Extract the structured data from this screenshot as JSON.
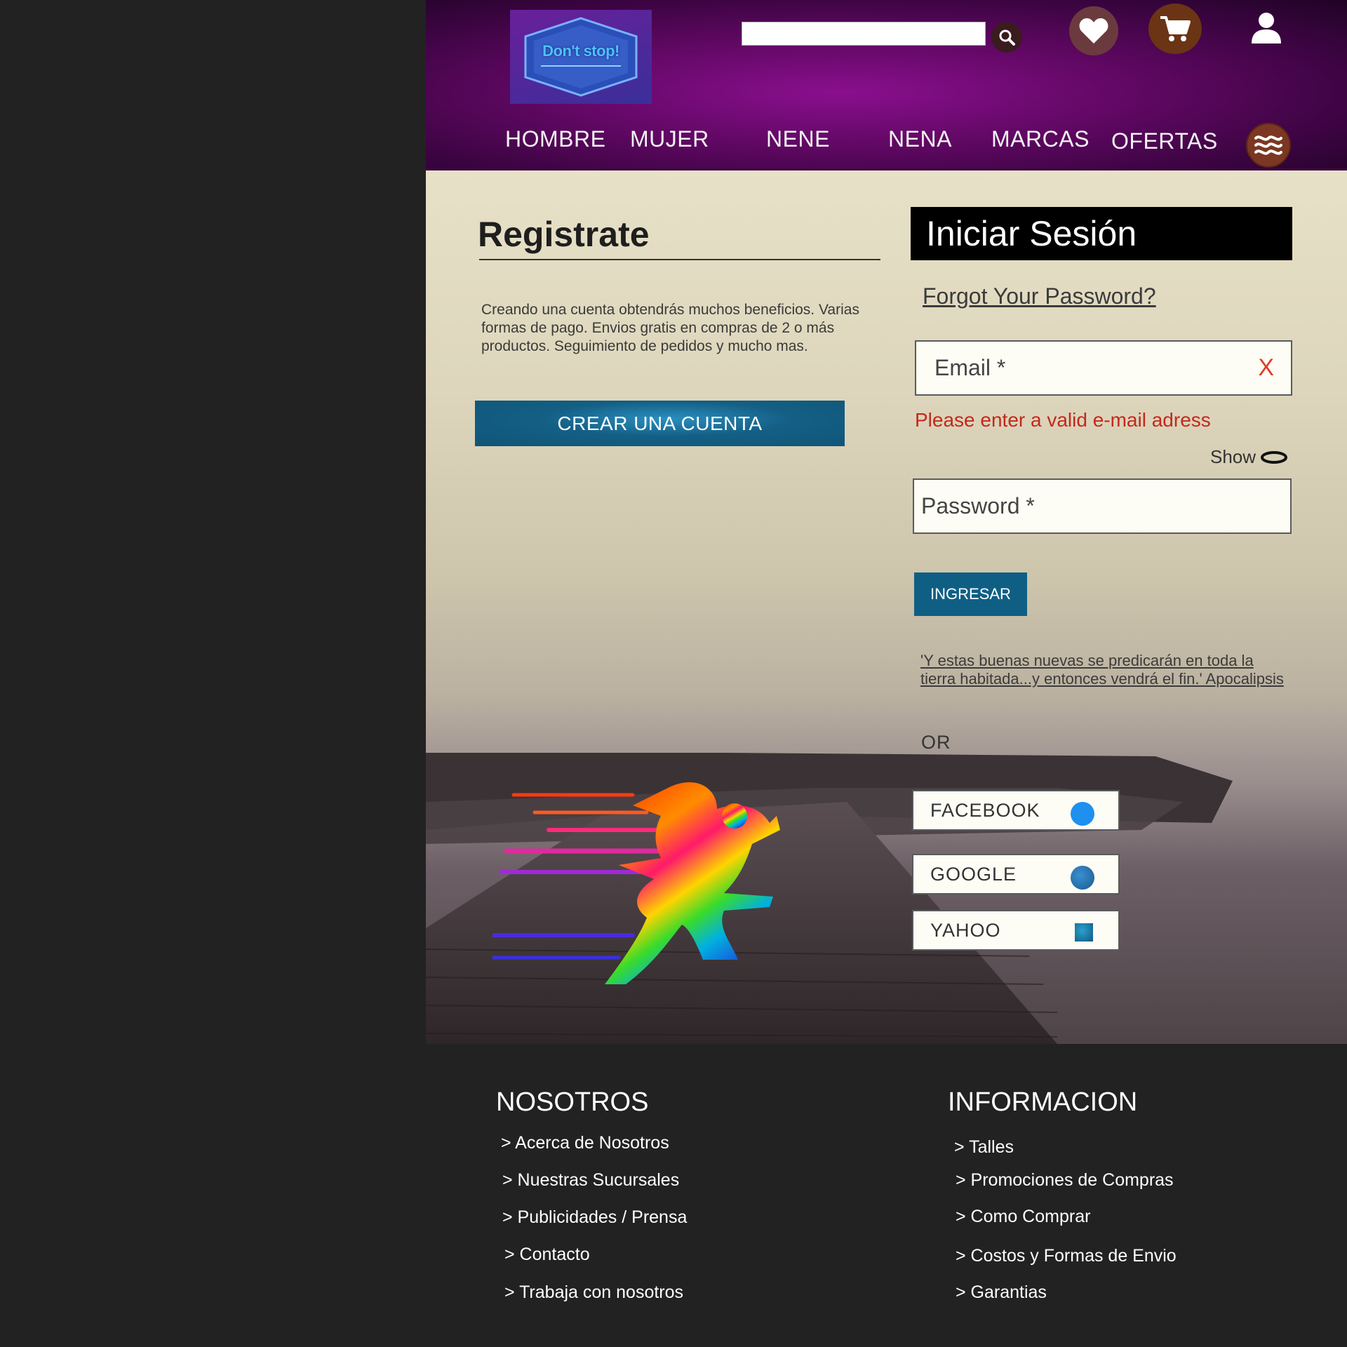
{
  "header": {
    "logo_text": "Don't stop!",
    "search": {
      "value": "",
      "placeholder": ""
    },
    "nav": [
      "HOMBRE",
      "MUJER",
      "NENE",
      "NENA",
      "MARCAS",
      "OFERTAS"
    ]
  },
  "register": {
    "title": "Registrate",
    "description": "Creando una cuenta obtendrás muchos beneficios. Varias formas de pago. Envios gratis en compras de 2 o más productos. Seguimiento de pedidos y mucho mas.",
    "button": "CREAR UNA CUENTA"
  },
  "login": {
    "title": "Iniciar Sesión",
    "forgot": "Forgot Your Password?",
    "email": {
      "value": "",
      "placeholder": "Email *"
    },
    "clear": "X",
    "error": "Please enter a valid e-mail adress",
    "show": "Show",
    "password": {
      "value": "",
      "placeholder": "Password *"
    },
    "submit": "INGRESAR",
    "quote": "'Y estas buenas nuevas se predicarán en toda la tierra habitada...y entonces vendrá el fin.' Apocalipsis",
    "or": "OR",
    "social": [
      {
        "label": "FACEBOOK",
        "color": "#1e90f0"
      },
      {
        "label": "GOOGLE",
        "color": "#2a78b8"
      },
      {
        "label": "YAHOO",
        "color": "#1a80b0"
      }
    ]
  },
  "footer": {
    "nosotros": {
      "title": "NOSOTROS",
      "links": [
        "> Acerca de Nosotros",
        "> Nuestras Sucursales",
        "> Publicidades / Prensa",
        "> Contacto",
        "> Trabaja con nosotros"
      ]
    },
    "informacion": {
      "title": "INFORMACION",
      "links": [
        "> Talles",
        "> Promociones de Compras",
        "> Como Comprar",
        "> Costos y Formas de Envio",
        "> Garantias"
      ]
    }
  },
  "colors": {
    "header_purple": "#6a0a70",
    "primary_button": "#0f5f85",
    "error_red": "#c4281c",
    "footer_bg": "#222222"
  },
  "icons": [
    "search-icon",
    "heart-icon",
    "cart-icon",
    "user-icon",
    "menu-icon",
    "eye-icon",
    "runner-logo"
  ]
}
